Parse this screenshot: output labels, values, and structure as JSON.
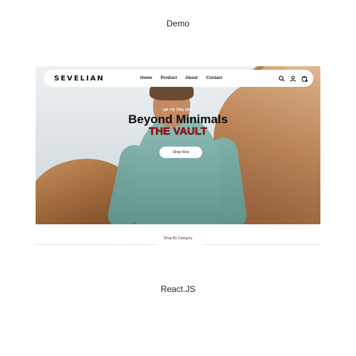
{
  "captions": {
    "top": "Demo",
    "bottom": "React.JS"
  },
  "nav": {
    "logo": "SEVELIAN",
    "menu": [
      "Home",
      "Product",
      "About",
      "Contact"
    ],
    "icons": [
      "search-icon",
      "user-icon",
      "cart-icon"
    ]
  },
  "hero": {
    "promo": "UP TO 70% OFF",
    "headline": "Beyond Minimals",
    "subhead": "THE VAULT",
    "button_label": "Shop Now"
  },
  "section": {
    "category_label": "Shop By Category"
  },
  "colors": {
    "accent_red": "#c3121e",
    "headline_black": "#0b0b0b"
  }
}
